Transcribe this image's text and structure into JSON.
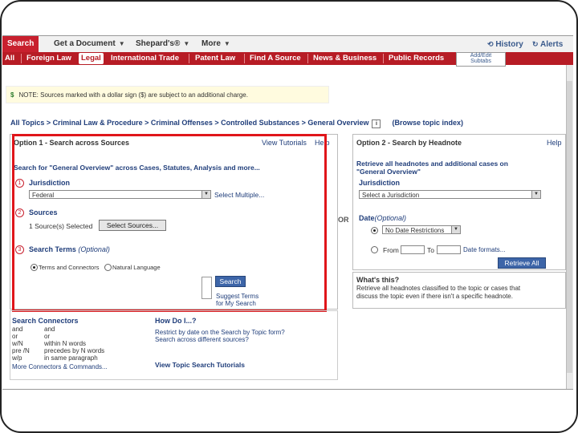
{
  "toolbar": {
    "tabs": [
      {
        "label": "Search",
        "active": true
      },
      {
        "label": "Get a Document"
      },
      {
        "label": "Shepard's®"
      },
      {
        "label": "More"
      }
    ],
    "history_label": "History",
    "alerts_label": "Alerts"
  },
  "categories": [
    {
      "label": "All"
    },
    {
      "label": "Foreign Law"
    },
    {
      "label": "Legal",
      "active": true
    },
    {
      "label": "International Trade"
    },
    {
      "label": "Patent Law"
    },
    {
      "label": "Find A Source"
    },
    {
      "label": "News & Business"
    },
    {
      "label": "Public Records"
    }
  ],
  "add_edit": {
    "line1": "Add/Edit",
    "line2": "Subtabs"
  },
  "note": {
    "dollar": "$",
    "prefix": "NOTE:",
    "text": "Sources marked with a dollar sign ($) are subject to an additional charge."
  },
  "breadcrumb": {
    "path": "All Topics > Criminal Law & Procedure > Criminal Offenses > Controlled Substances > General Overview",
    "info": "i",
    "browse": "(Browse topic index)"
  },
  "option1": {
    "title": "Option 1 - Search across Sources",
    "tutorials": "View Tutorials",
    "help": "Help",
    "heading": "Search for \"General Overview\" across Cases, Statutes, Analysis and more...",
    "jurisdiction_label": "Jurisdiction",
    "jurisdiction_value": "Federal",
    "select_multiple": "Select Multiple...",
    "sources_label": "Sources",
    "sources_selected": "1 Source(s) Selected",
    "select_sources": "Select Sources...",
    "search_terms_label": "Search Terms",
    "search_terms_optional": "(Optional)",
    "terms_connectors": "Terms and Connectors",
    "natural_language": "Natural Language",
    "search_button": "Search",
    "suggest_line1": "Suggest Terms",
    "suggest_line2": "for My Search"
  },
  "connectors": {
    "title": "Search Connectors",
    "rows": [
      {
        "key": "and",
        "desc": "and"
      },
      {
        "key": "or",
        "desc": "or"
      },
      {
        "key": "w/N",
        "desc": "within N words"
      },
      {
        "key": "pre /N",
        "desc": "precedes by N words"
      },
      {
        "key": "w/p",
        "desc": "in same paragraph"
      }
    ],
    "more": "More Connectors & Commands..."
  },
  "howdoi": {
    "title": "How Do I...?",
    "q1": "Restrict by date on the Search by Topic form?",
    "q2": "Search across different sources?",
    "tutorials": "View Topic Search Tutorials"
  },
  "or_label": "OR",
  "option2": {
    "title": "Option 2 - Search by Headnote",
    "help": "Help",
    "heading_line1": "Retrieve all headnotes and additional cases on",
    "heading_line2": "\"General Overview\"",
    "jurisdiction_label": "Jurisdiction",
    "jurisdiction_placeholder": "Select a Jurisdiction",
    "date_label": "Date",
    "date_optional": "(Optional)",
    "no_date": "No Date Restrictions",
    "from": "From",
    "to": "To",
    "date_formats": "Date formats...",
    "retrieve_button": "Retrieve All",
    "whats_this": "What's this?",
    "desc_line1": "Retrieve all headnotes classified to the topic or cases that",
    "desc_line2": "discuss the topic even if there isn't a specific headnote."
  },
  "colors": {
    "brand_red": "#c8202e",
    "category_red": "#b71c25",
    "link_blue": "#1f3d7a",
    "highlight_red": "#e0151a"
  }
}
